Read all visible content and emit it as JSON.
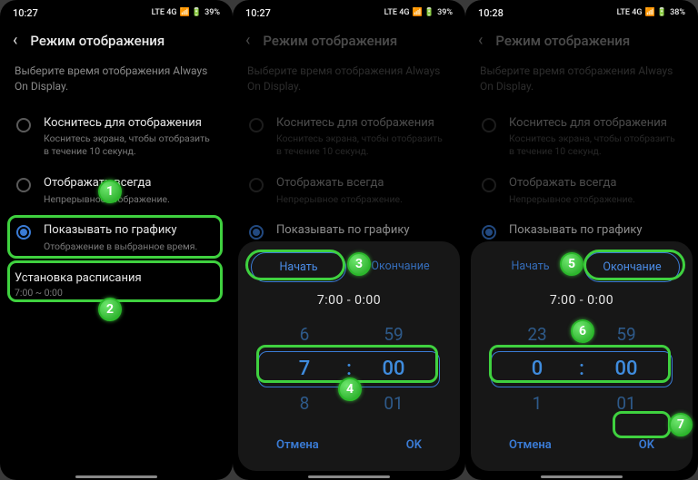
{
  "status": {
    "time_a": "10:27",
    "time_b": "10:27",
    "time_c": "10:28",
    "battery_a": "39%",
    "battery_b": "39%",
    "battery_c": "38%",
    "net": "LTE 4G"
  },
  "header": {
    "back": "‹",
    "title": "Режим отображения"
  },
  "desc": "Выберите время отображения Always On Display.",
  "options": {
    "tap": {
      "title": "Коснитесь для отображения",
      "sub": "Коснитесь экрана, чтобы отобразить в течение 10 секунд."
    },
    "always": {
      "title": "Отображать всегда",
      "sub": "Непрерывное отображение."
    },
    "sched": {
      "title": "Показывать по графику",
      "sub": "Отображение в выбранное время."
    }
  },
  "schedule": {
    "title": "Установка расписания",
    "range": "7:00 ~ 0:00"
  },
  "sheet": {
    "start_label": "Начать",
    "end_label": "Окончание",
    "range": "7:00   -   0:00",
    "cancel": "Отмена",
    "ok": "OK",
    "picker_start": {
      "prev_h": "6",
      "prev_m": "59",
      "h": "7",
      "m": "00",
      "next_h": "8",
      "next_m": "01"
    },
    "picker_end": {
      "prev_h": "23",
      "prev_m": "59",
      "h": "0",
      "m": "00",
      "next_h": "1",
      "next_m": "01"
    }
  },
  "badges": {
    "b1": "1",
    "b2": "2",
    "b3": "3",
    "b4": "4",
    "b5": "5",
    "b6": "6",
    "b7": "7"
  }
}
